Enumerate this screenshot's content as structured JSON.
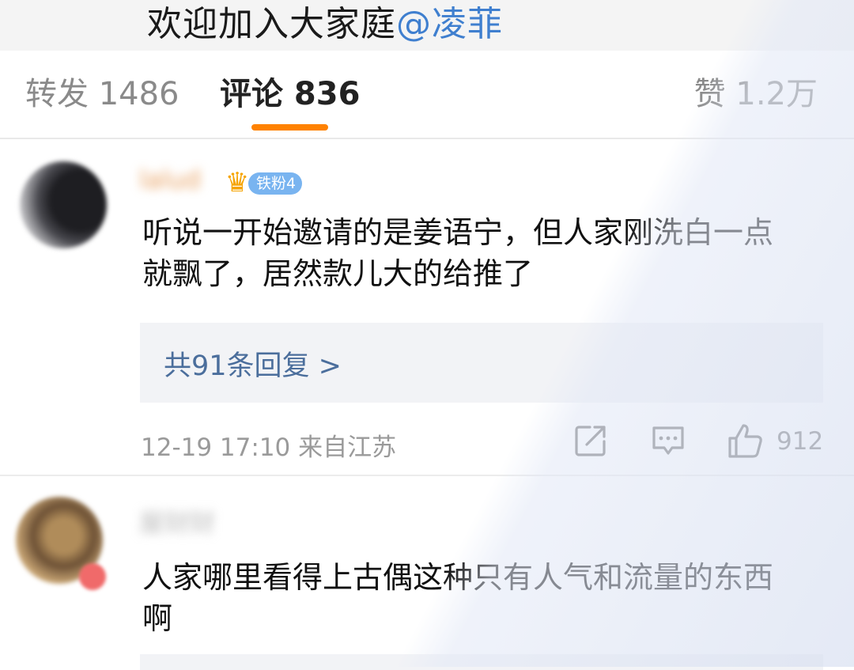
{
  "post": {
    "title_prefix": "欢迎加入大家庭",
    "mention": "@凌菲"
  },
  "tabs": {
    "repost": "转发 1486",
    "comment": "评论 836",
    "like": "赞 1.2万"
  },
  "comments": [
    {
      "username": "lalud",
      "fan_badge": "铁粉4",
      "text": "听说一开始邀请的是姜语宁，但人家刚洗白一点就飘了，居然款儿大的给推了",
      "replies_link": "共91条回复 >",
      "time": "12-19 17:10",
      "location": "来自江苏",
      "likes": "912"
    },
    {
      "username": "屋财财",
      "text": "人家哪里看得上古偶这种只有人气和流量的东西啊"
    }
  ],
  "icons": {
    "share": "share-icon",
    "reply": "comment-icon",
    "like": "thumbs-up-icon",
    "crown": "crown-icon"
  },
  "colors": {
    "accent": "#ff8200",
    "mention": "#3f7fcf",
    "reply_link": "#4b6e9c",
    "fan_badge": "#79b4f0"
  }
}
